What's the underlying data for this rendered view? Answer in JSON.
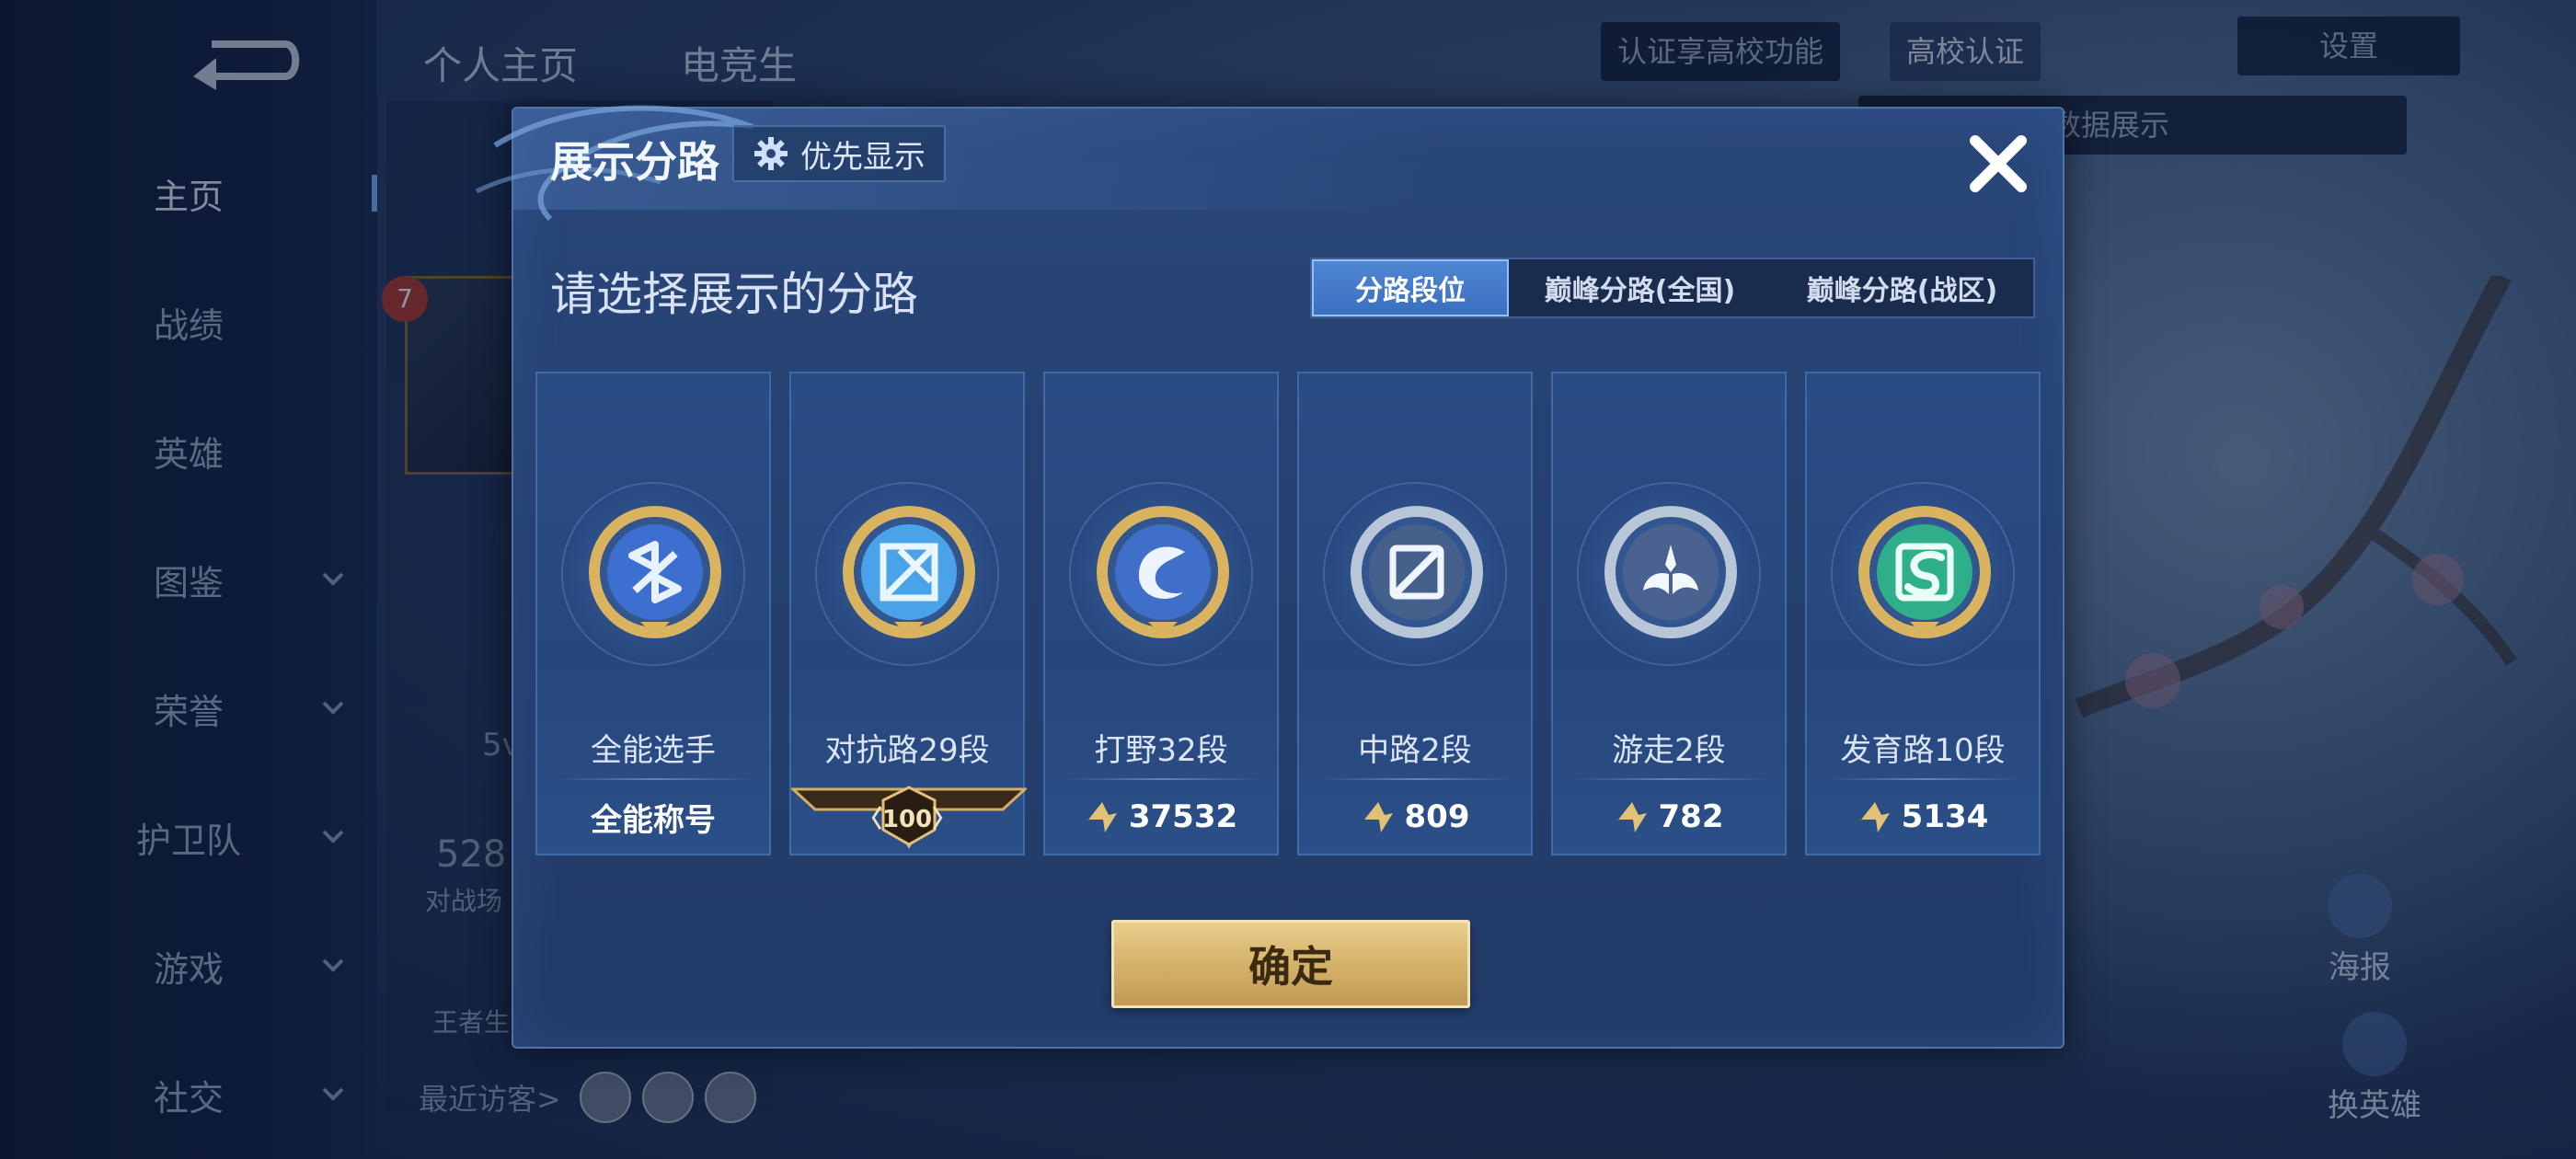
{
  "background": {
    "sidebar": {
      "items": [
        {
          "label": "主页",
          "active": true,
          "chevron": false
        },
        {
          "label": "战绩",
          "active": false,
          "chevron": false
        },
        {
          "label": "英雄",
          "active": false,
          "chevron": false
        },
        {
          "label": "图鉴",
          "active": false,
          "chevron": true
        },
        {
          "label": "荣誉",
          "active": false,
          "chevron": true
        },
        {
          "label": "护卫队",
          "active": false,
          "chevron": true
        },
        {
          "label": "游戏",
          "active": false,
          "chevron": true
        },
        {
          "label": "社交",
          "active": false,
          "chevron": true
        }
      ]
    },
    "top_tabs": [
      "个人主页",
      "电竞生"
    ],
    "campus_prompt": "认证享高校功能",
    "campus_button": "高校认证",
    "settings_label": "设置",
    "hint_text": "以切换灵宝和数据展示",
    "level": "7",
    "stat_text": "5v",
    "number_text": "528",
    "number_sub": "对战场",
    "glory_text": "王者生",
    "recent_visitors": "最近访客>",
    "poster_label": "海报",
    "switch_hero_label": "换英雄"
  },
  "dialog": {
    "title": "展示分路",
    "priority_button": "优先显示",
    "subtitle": "请选择展示的分路",
    "segment_tabs": [
      {
        "label": "分路段位",
        "active": true
      },
      {
        "label": "巅峰分路(全国)",
        "active": false
      },
      {
        "label": "巅峰分路(战区)",
        "active": false
      }
    ],
    "cards": [
      {
        "name": "全能选手",
        "stat": "全能称号",
        "stat_type": "title",
        "emblem": "all-round-emblem-icon",
        "ring_color": "#d9b35f",
        "core_color": "#3c6fd0"
      },
      {
        "name": "对抗路29段",
        "stat": "100",
        "stat_type": "banner",
        "emblem": "clash-lane-emblem-icon",
        "ring_color": "#d9b35f",
        "core_color": "#4aa3e8"
      },
      {
        "name": "打野32段",
        "stat": "37532",
        "stat_type": "points",
        "emblem": "jungle-emblem-icon",
        "ring_color": "#d9b35f",
        "core_color": "#3f6fc8"
      },
      {
        "name": "中路2段",
        "stat": "809",
        "stat_type": "points",
        "emblem": "mid-lane-emblem-icon",
        "ring_color": "#b9c6d8",
        "core_color": "#46608c"
      },
      {
        "name": "游走2段",
        "stat": "782",
        "stat_type": "points",
        "emblem": "roam-emblem-icon",
        "ring_color": "#b9c6d8",
        "core_color": "#4a6290"
      },
      {
        "name": "发育路10段",
        "stat": "5134",
        "stat_type": "points",
        "emblem": "farm-lane-emblem-icon",
        "ring_color": "#d9b35f",
        "core_color": "#2fae8a"
      }
    ],
    "confirm_button": "确定"
  },
  "colors": {
    "accent_blue": "#3a6fbf",
    "gold": "#d7b56c",
    "dialog_bg": "#243f6e"
  }
}
